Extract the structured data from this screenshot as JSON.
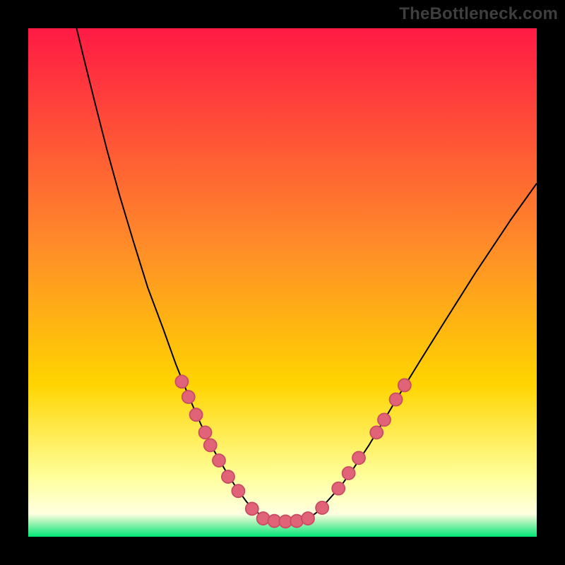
{
  "watermark": "TheBottleneck.com",
  "colors": {
    "page_bg": "#000000",
    "grad_top": "#ff1a44",
    "grad_mid": "#ffd400",
    "grad_low": "#ffff99",
    "grad_green": "#00e676",
    "curve": "#000000",
    "marker_fill": "#e06377",
    "marker_stroke": "#c94c63"
  },
  "chart_data": {
    "type": "line",
    "title": "",
    "xlabel": "",
    "ylabel": "",
    "xlim": [
      0,
      100
    ],
    "ylim": [
      0,
      100
    ],
    "curve": {
      "name": "bottleneck-curve",
      "points": [
        {
          "x": 9.5,
          "y": 100
        },
        {
          "x": 11.2,
          "y": 93
        },
        {
          "x": 13.2,
          "y": 85
        },
        {
          "x": 15.5,
          "y": 76
        },
        {
          "x": 18.0,
          "y": 67
        },
        {
          "x": 20.7,
          "y": 58
        },
        {
          "x": 23.5,
          "y": 49
        },
        {
          "x": 26.5,
          "y": 41
        },
        {
          "x": 29.0,
          "y": 34
        },
        {
          "x": 31.6,
          "y": 27.5
        },
        {
          "x": 34.0,
          "y": 22
        },
        {
          "x": 36.5,
          "y": 17
        },
        {
          "x": 38.8,
          "y": 13
        },
        {
          "x": 41.0,
          "y": 9.5
        },
        {
          "x": 43.0,
          "y": 6.8
        },
        {
          "x": 45.0,
          "y": 4.8
        },
        {
          "x": 47.0,
          "y": 3.5
        },
        {
          "x": 49.0,
          "y": 3.0
        },
        {
          "x": 51.0,
          "y": 3.0
        },
        {
          "x": 53.0,
          "y": 3.0
        },
        {
          "x": 55.0,
          "y": 3.5
        },
        {
          "x": 57.0,
          "y": 5.0
        },
        {
          "x": 59.0,
          "y": 7.2
        },
        {
          "x": 61.5,
          "y": 10.0
        },
        {
          "x": 64.0,
          "y": 13.5
        },
        {
          "x": 67.0,
          "y": 18.0
        },
        {
          "x": 70.0,
          "y": 23.0
        },
        {
          "x": 73.0,
          "y": 28.0
        },
        {
          "x": 77.0,
          "y": 34.5
        },
        {
          "x": 82.0,
          "y": 42.5
        },
        {
          "x": 88.0,
          "y": 52.0
        },
        {
          "x": 95.0,
          "y": 62.5
        },
        {
          "x": 100.0,
          "y": 69.5
        }
      ]
    },
    "markers_left": [
      {
        "x": 30.2,
        "y": 30.5
      },
      {
        "x": 31.5,
        "y": 27.5
      },
      {
        "x": 33.0,
        "y": 24.0
      },
      {
        "x": 34.8,
        "y": 20.5
      },
      {
        "x": 35.8,
        "y": 18.0
      },
      {
        "x": 37.5,
        "y": 15.0
      },
      {
        "x": 39.3,
        "y": 11.8
      },
      {
        "x": 41.3,
        "y": 9.0
      },
      {
        "x": 44.0,
        "y": 5.5
      }
    ],
    "markers_bottom": [
      {
        "x": 46.2,
        "y": 3.6
      },
      {
        "x": 48.4,
        "y": 3.1
      },
      {
        "x": 50.6,
        "y": 3.0
      },
      {
        "x": 52.8,
        "y": 3.1
      },
      {
        "x": 55.0,
        "y": 3.6
      }
    ],
    "markers_right": [
      {
        "x": 57.8,
        "y": 5.7
      },
      {
        "x": 61.0,
        "y": 9.5
      },
      {
        "x": 63.0,
        "y": 12.5
      },
      {
        "x": 65.0,
        "y": 15.5
      },
      {
        "x": 68.5,
        "y": 20.5
      },
      {
        "x": 70.0,
        "y": 23.0
      },
      {
        "x": 72.3,
        "y": 27.0
      },
      {
        "x": 74.0,
        "y": 29.8
      }
    ]
  }
}
